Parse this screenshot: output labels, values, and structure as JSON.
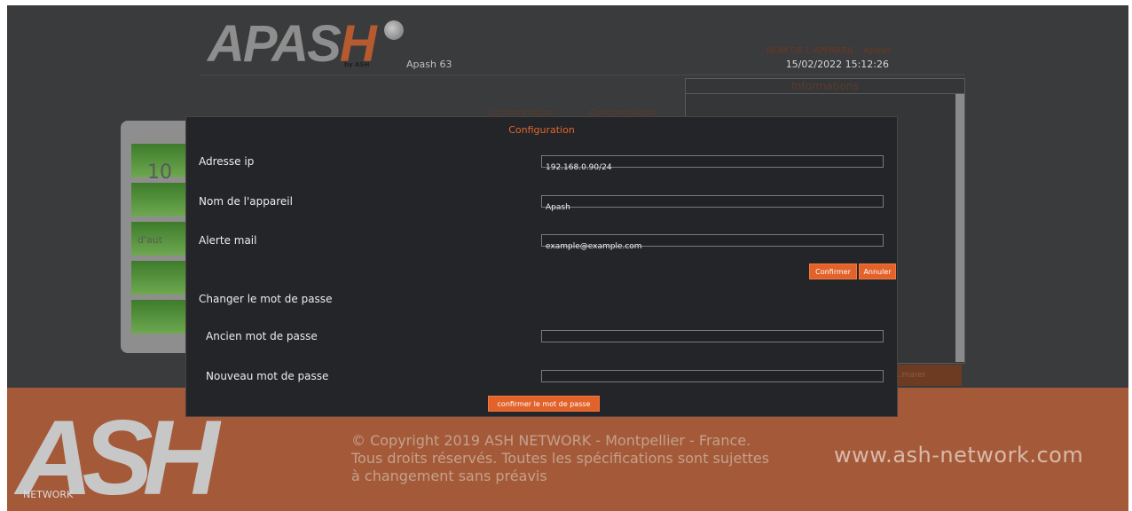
{
  "header": {
    "logo_main": "APAS",
    "logo_h": "H",
    "logo_sub": "by ASH",
    "device_short": "Apash 63",
    "device_name_line": "NOM DE L'APPAREIL : Apash",
    "datetime": "15/02/2022 15:12:26"
  },
  "info_panel": {
    "title": "Informations",
    "button_label": "...marer"
  },
  "background_labels": {
    "consumption_1": "Consommation",
    "consumption_2": "Consommation",
    "battery_value": "10",
    "battery_label": "d'aut"
  },
  "modal": {
    "title": "Configuration",
    "ip": {
      "label": "Adresse ip",
      "value": "192.168.0.90/24"
    },
    "device": {
      "label": "Nom de l'appareil",
      "value": "Apash"
    },
    "mail": {
      "label": "Alerte mail",
      "value": "example@example.com"
    },
    "confirm_label": "Confirmer",
    "cancel_label": "Annuler",
    "password_section": "Changer le mot de passe",
    "old_password": {
      "label": "Ancien mot de passe",
      "value": ""
    },
    "new_password": {
      "label": "Nouveau mot de passe",
      "value": ""
    },
    "confirm_password_label": "confirmer le mot de passe"
  },
  "footer": {
    "logo_text": "ASH",
    "logo_network": "NETWORK",
    "copyright_1": "© Copyright 2019 ASH NETWORK - Montpellier - France.",
    "copyright_2": "Tous droits réservés. Toutes les spécifications sont sujettes",
    "copyright_3": "à changement sans préavis",
    "website": "www.ash-network.com"
  },
  "colors": {
    "accent": "#e2622a",
    "footer_bg": "#a45a39",
    "page_bg": "#3a3b3d",
    "modal_bg": "#232528"
  }
}
